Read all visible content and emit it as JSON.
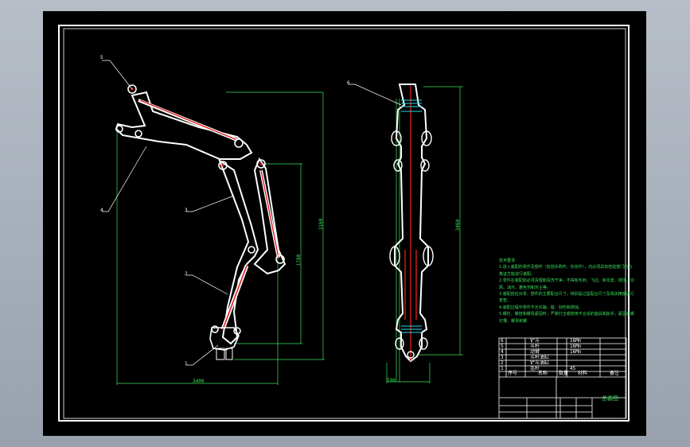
{
  "drawing": {
    "part_callouts": [
      "5",
      "4",
      "3",
      "2",
      "1",
      "6"
    ],
    "dimensions": [
      "3400",
      "3160",
      "1780",
      "3460",
      "590"
    ],
    "colors": {
      "background": "#000000",
      "outline": "#ffffff",
      "dimension": "#3de35b",
      "hydraulic_cylinder": "#e02020",
      "callout": "#ffffff"
    }
  },
  "technical_requirements": {
    "heading": "技术要求",
    "lines": [
      "1.进入装配的零件及部件（包括外购件、外协件），均必须具有检验部门的合",
      "格证方能进行装配。",
      "2.零件在装配前必须清理和清洗干净，不得有毛刺、飞边、氧化皮、锈蚀、切",
      "屑、油污、着色剂和灰尘等。",
      "3.装配前应对零、部件的主要配合尺寸，特别是过盈配合尺寸及相关精度进行",
      "复查。",
      "4.装配过程中零件不允许磕、碰、划伤和锈蚀。",
      "5.螺钉、螺栓和螺母紧固时，严禁打击或使用不合适的旋具和扳手。紧固后螺",
      "钉槽、螺母和螺"
    ]
  },
  "title_block": {
    "header_cells": [
      "序号",
      "名称",
      "数量",
      "材料",
      "备注"
    ],
    "part_rows": [
      [
        "6",
        "铲斗",
        "1",
        "16Mn",
        ""
      ],
      [
        "5",
        "斗杆",
        "1",
        "16Mn",
        ""
      ],
      [
        "4",
        "动臂",
        "1",
        "16Mn",
        ""
      ],
      [
        "3",
        "斗杆油缸",
        "1",
        "",
        ""
      ],
      [
        "2",
        "铲斗油缸",
        "1",
        "",
        ""
      ],
      [
        "1",
        "连杆",
        "2",
        "45",
        ""
      ]
    ],
    "drawing_name": "总装图"
  }
}
